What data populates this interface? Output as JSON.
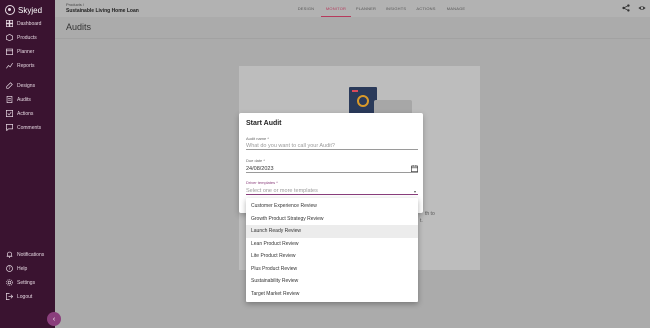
{
  "brand": {
    "name": "Skyjed"
  },
  "sidebar": {
    "items": [
      {
        "label": "Dashboard",
        "icon": "dashboard-icon"
      },
      {
        "label": "Products",
        "icon": "products-icon"
      },
      {
        "label": "Planner",
        "icon": "planner-icon"
      },
      {
        "label": "Reports",
        "icon": "reports-icon"
      },
      {
        "label": "Designs",
        "icon": "designs-icon"
      },
      {
        "label": "Audits",
        "icon": "audits-icon"
      },
      {
        "label": "Actions",
        "icon": "actions-icon"
      },
      {
        "label": "Comments",
        "icon": "comments-icon"
      }
    ],
    "bottom_items": [
      {
        "label": "Notifications",
        "icon": "bell-icon"
      },
      {
        "label": "Help",
        "icon": "help-icon"
      },
      {
        "label": "Settings",
        "icon": "gear-icon"
      },
      {
        "label": "Logout",
        "icon": "logout-icon"
      }
    ],
    "collapse_glyph": "‹"
  },
  "header": {
    "crumb": "Products /",
    "product_title": "Sustainable Living Home Loan",
    "tabs": [
      "DESIGN",
      "MONITOR",
      "PLANNER",
      "INSIGHTS",
      "ACTIONS",
      "MANAGE"
    ],
    "active_tab": "MONITOR"
  },
  "page": {
    "title": "Audits",
    "behind_text_1": "th to",
    "behind_text_2": "t."
  },
  "dialog": {
    "title": "Start Audit",
    "audit_name_label": "Audit name *",
    "audit_name_placeholder": "What do you want to call your Audit?",
    "due_date_label": "Due date *",
    "due_date_value": "24/08/2023",
    "templates_label": "Driver templates *",
    "templates_placeholder": "Select one or more templates",
    "caret": "▾"
  },
  "dropdown": {
    "options": [
      "Customer Experience Review",
      "Growth Product Strategy Review",
      "Launch Ready Review",
      "Lean Product Review",
      "Lite Product Review",
      "Plus Product Review",
      "Sustainability Review",
      "Target Market Review"
    ],
    "hovered_index": 2
  },
  "colors": {
    "sidebar_bg": "#3a1330",
    "accent": "#8a3e7c",
    "active_tab": "#b63a5c"
  }
}
